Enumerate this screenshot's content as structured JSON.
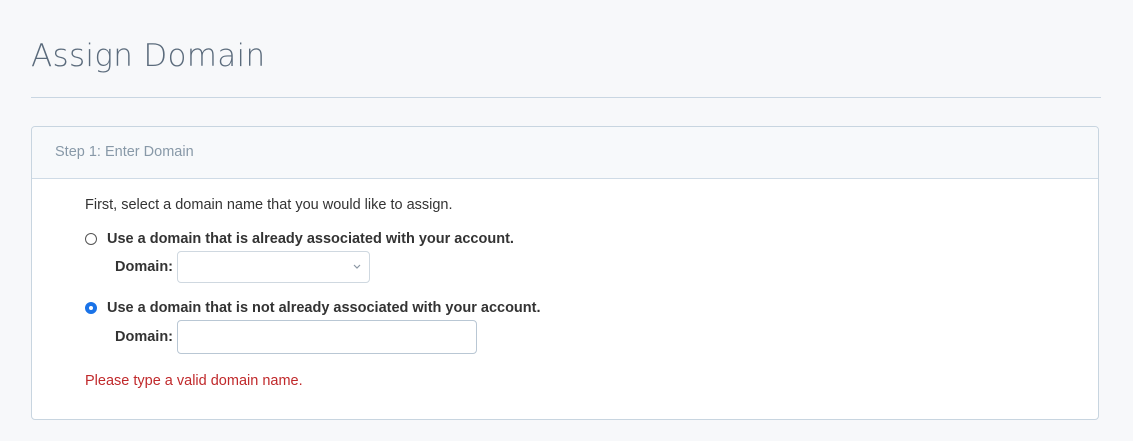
{
  "page": {
    "title": "Assign Domain"
  },
  "panel": {
    "heading": "Step 1: Enter Domain",
    "intro": "First, select a domain name that you would like to assign."
  },
  "options": {
    "existing": {
      "label": "Use a domain that is already associated with your account.",
      "checked": false,
      "field_label": "Domain:",
      "selected_value": ""
    },
    "new": {
      "label": "Use a domain that is not already associated with your account.",
      "checked": true,
      "field_label": "Domain:",
      "value": "",
      "placeholder": ""
    }
  },
  "error": {
    "message": "Please type a valid domain name."
  },
  "colors": {
    "error": "#c0292b",
    "radio_selected": "#1a73e8",
    "title": "#5b6b7c"
  },
  "icons": {
    "select_chevron": "chevron-down-icon"
  }
}
